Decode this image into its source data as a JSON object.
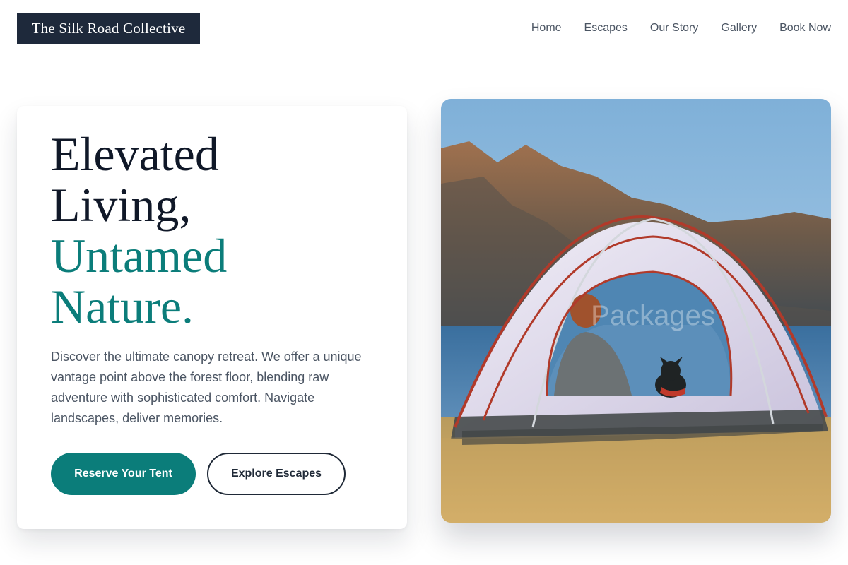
{
  "header": {
    "brand": "The Silk Road Collective",
    "nav": [
      {
        "label": "Home"
      },
      {
        "label": "Escapes"
      },
      {
        "label": "Our Story"
      },
      {
        "label": "Gallery"
      },
      {
        "label": "Book Now"
      }
    ]
  },
  "hero": {
    "headline_lines": [
      "Elevated",
      "Living,",
      "Untamed",
      "Nature."
    ],
    "description": "Discover the ultimate canopy retreat. We offer a unique vantage point above the forest floor, blending raw adventure with sophisticated comfort. Navigate landscapes, deliver memories.",
    "primary_cta": "Reserve Your Tent",
    "secondary_cta": "Explore Escapes",
    "image": {
      "watermark": "Packages"
    }
  },
  "colors": {
    "brand_navy": "#1e293b",
    "accent_teal": "#0b7d7a",
    "heading": "#101828",
    "body_text": "#4b5563"
  }
}
